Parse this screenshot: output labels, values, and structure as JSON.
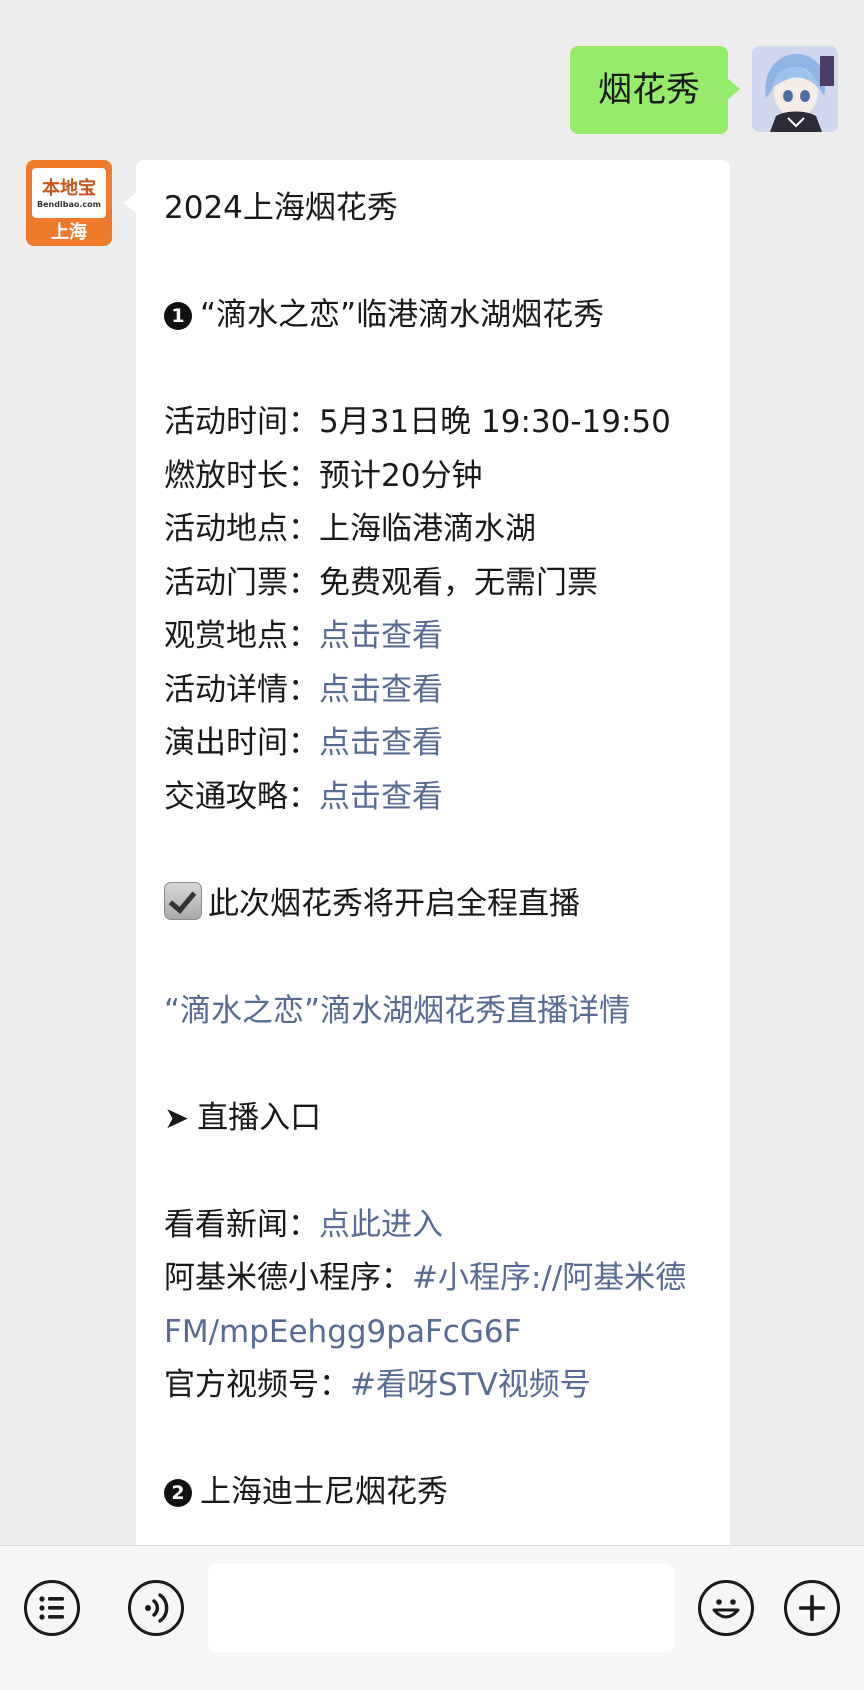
{
  "outgoing": {
    "text": "烟花秀"
  },
  "sender": {
    "logo_text": "本地宝",
    "logo_url": "Bendibao.com",
    "city": "上海"
  },
  "message": {
    "title": "2024上海烟花秀",
    "section1": {
      "number": "1",
      "title": "“滴水之恋”临港滴水湖烟花秀"
    },
    "time_label": "活动时间：",
    "time_value": "5月31日晚 19:30-19:50",
    "duration_label": "燃放时长：",
    "duration_value": "预计20分钟",
    "location_label": "活动地点：",
    "location_value": "上海临港滴水湖",
    "ticket_label": "活动门票：",
    "ticket_value": "免费观看，无需门票",
    "viewing_label": "观赏地点：",
    "details_label": "活动详情：",
    "showtime_label": "演出时间：",
    "transport_label": "交通攻略：",
    "view_link": "点击查看",
    "live_notice": "此次烟花秀将开启全程直播",
    "live_details_link": "“滴水之恋”滴水湖烟花秀直播详情",
    "live_entry": "直播入口",
    "news_label": "看看新闻：",
    "news_link": "点此进入",
    "app_label": "阿基米德小程序：",
    "app_link": "#小程序://阿基米德FM/mpEehgg9paFcG6F",
    "channel_label": "官方视频号：",
    "channel_link": "#看呀STV视频号",
    "section2": {
      "number": "2",
      "title": "上海迪士尼烟花秀"
    }
  },
  "bottom_bar": {
    "input_value": ""
  }
}
